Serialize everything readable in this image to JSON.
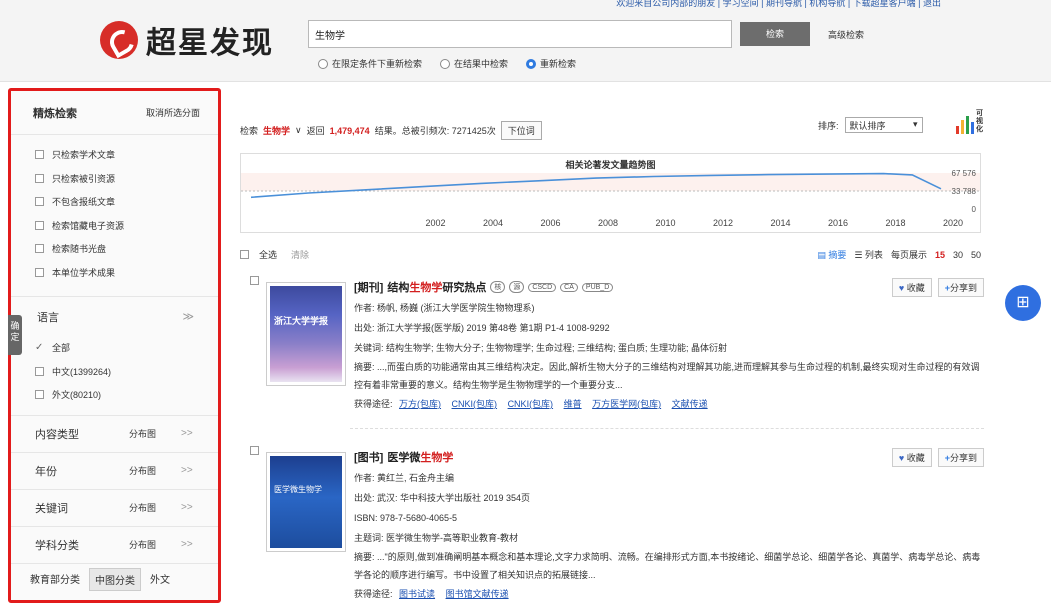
{
  "header": {
    "top_links": "欢迎来自公司内部的朋友 | 学习空间 | 期刊导航 | 机构导航 | 下载超星客户端 | 退出",
    "logo_text": "超星发现",
    "search_value": "生物学",
    "search_button": "检索",
    "advanced_link": "高级检索",
    "radios": [
      {
        "label": "在限定条件下重新检索",
        "selected": false
      },
      {
        "label": "在结果中检索",
        "selected": false
      },
      {
        "label": "重新检索",
        "selected": true
      }
    ]
  },
  "sidebar": {
    "title": "精炼检索",
    "clear_facets": "取消所选分面",
    "filters": [
      "只检索学术文章",
      "只检索被引资源",
      "不包含报纸文章",
      "检索馆藏电子资源",
      "检索随书光盘",
      "本单位学术成果"
    ],
    "confirm_tab": "确定",
    "language": {
      "title": "语言",
      "expand": "≫",
      "options": [
        {
          "label": "全部",
          "checked": true
        },
        {
          "label": "中文(1399264)",
          "checked": false
        },
        {
          "label": "外文(80210)",
          "checked": false
        }
      ]
    },
    "facets": [
      {
        "label": "内容类型",
        "dist": "分布图",
        "arrow": ">>"
      },
      {
        "label": "年份",
        "dist": "分布图",
        "arrow": ">>"
      },
      {
        "label": "关键词",
        "dist": "分布图",
        "arrow": ">>"
      },
      {
        "label": "学科分类",
        "dist": "分布图",
        "arrow": ">>"
      }
    ],
    "class_tabs": [
      {
        "label": "教育部分类",
        "active": false
      },
      {
        "label": "中图分类",
        "active": true
      },
      {
        "label": "外文",
        "active": false
      }
    ]
  },
  "summary": {
    "prefix": "检索",
    "term": "生物学",
    "dropdown": "∨",
    "returned": "返回",
    "count": "1,479,474",
    "results_text": "结果。总被引频次: 7271425次",
    "lower_words": "下位词"
  },
  "sort": {
    "label": "排序:",
    "value": "默认排序",
    "arrow": "▾"
  },
  "viz_label": "可视化",
  "chart_data": {
    "type": "line",
    "title": "相关论著发文量趋势图",
    "x": [
      1996,
      1998,
      2000,
      2002,
      2004,
      2006,
      2008,
      2010,
      2012,
      2014,
      2016,
      2018,
      2019,
      2020
    ],
    "series": [
      {
        "values": [
          22000,
          30000,
          36000,
          42000,
          48000,
          53000,
          58000,
          61000,
          63000,
          64500,
          65500,
          66500,
          64000,
          38000
        ]
      }
    ],
    "xticks": [
      "2002",
      "2004",
      "2006",
      "2008",
      "2010",
      "2012",
      "2014",
      "2016",
      "2018",
      "2020"
    ],
    "yticks": [
      "67 576",
      "33 788",
      "0"
    ],
    "ylim": [
      0,
      67576
    ],
    "xlim": [
      1996,
      2020
    ],
    "color": "#4a90d9"
  },
  "list_toolbar": {
    "select_all": "全选",
    "clear": "清除",
    "summary_view": "摘要",
    "list_view": "列表",
    "per_page": "每页展示",
    "pages": [
      "15",
      "30",
      "50"
    ],
    "active_page": "15"
  },
  "results": [
    {
      "type": "[期刊]",
      "title_pre": "结构",
      "title_hit": "生物学",
      "title_post": "研究热点",
      "tags": [
        "核",
        "源",
        "CSCD",
        "CA",
        "PUB_D"
      ],
      "author": "作者: 杨帆, 杨巍 (浙江大学医学院生物物理系)",
      "source": "出处: 浙江大学学报(医学版) 2019 第48卷 第1期 P1-4 1008-9292",
      "keywords": "关键词: 结构生物学; 生物大分子; 生物物理学; 生命过程; 三维结构; 蛋白质; 生理功能; 晶体衍射",
      "abstract": "摘要: ...,而蛋白质的功能通常由其三维结构决定。因此,解析生物大分子的三维结构对理解其功能,进而理解其参与生命过程的机制,最终实现对生命过程的有效调控有着非常重要的意义。结构生物学是生物物理学的一个重要分支...",
      "access_label": "获得途径:",
      "access": [
        "万方(包库)",
        "CNKI(包库)",
        "CNKI(包库)",
        "维普",
        "万方医学网(包库)",
        "文献传递"
      ],
      "cover_title": "浙江大学学报",
      "collect": "收藏",
      "share": "分享到"
    },
    {
      "type": "[图书]",
      "title_pre": "医学微",
      "title_hit": "生物学",
      "title_post": "",
      "tags": [],
      "author": "作者: 黄红兰, 石金舟主编",
      "source": "出处: 武汉: 华中科技大学出版社 2019 354页",
      "isbn": "ISBN: 978-7-5680-4065-5",
      "keywords": "主题词: 医学微生物学-高等职业教育-教材",
      "abstract": "摘要: ...\"的原则,做到准确阐明基本概念和基本理论,文字力求简明、流畅。在编排形式方面,本书按绪论、细菌学总论、细菌学各论、真菌学、病毒学总论、病毒学各论的顺序进行编写。书中设置了相关知识点的拓展链接...",
      "access_label": "获得途径:",
      "access": [
        "图书试读",
        "图书馆文献传递"
      ],
      "cover_title": "医学微生物学",
      "collect": "收藏",
      "share": "分享到"
    }
  ],
  "fab_icon": "grid-apps-icon"
}
